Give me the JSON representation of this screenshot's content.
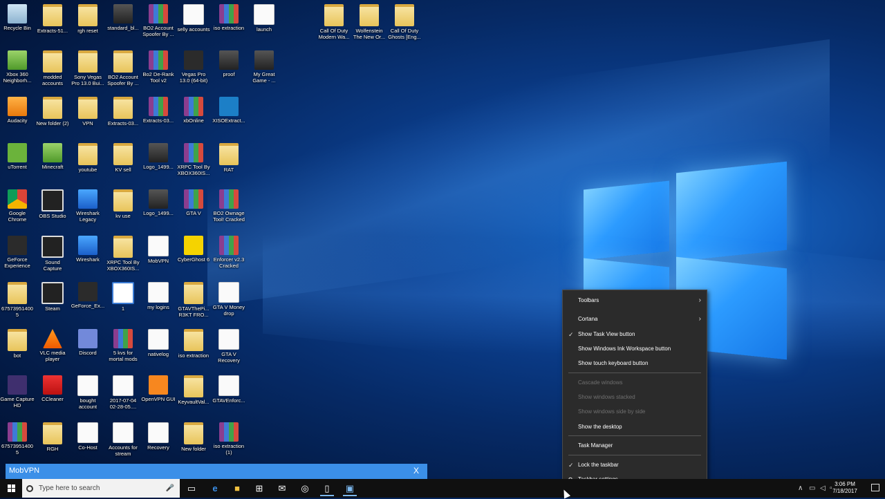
{
  "desktop": {
    "icons": [
      {
        "label": "Recycle Bin",
        "glyph": "recycle-bin-icon"
      },
      {
        "label": "Extracts-51...",
        "glyph": "folder-icon"
      },
      {
        "label": "rgh reset",
        "glyph": "folder-icon"
      },
      {
        "label": "standard_bl...",
        "glyph": "image-file-icon"
      },
      {
        "label": "BO2 Account Spoofer By ...",
        "glyph": "winrar-archive-icon"
      },
      {
        "label": "selly accounts",
        "glyph": "text-document-icon"
      },
      {
        "label": "iso extraction",
        "glyph": "winrar-archive-icon"
      },
      {
        "label": "launch",
        "glyph": "settings-file-icon"
      },
      {
        "label": "Call Of Duty Modern Wa...",
        "glyph": "folder-icon"
      },
      {
        "label": "Wolfenstein The New Or...",
        "glyph": "folder-icon"
      },
      {
        "label": "Call Of Duty Ghosts [Eng...",
        "glyph": "folder-icon"
      },
      {
        "label": "Xbox 360 Neighborh...",
        "glyph": "xbox-neighborhood-icon"
      },
      {
        "label": "modded accounts",
        "glyph": "folder-icon"
      },
      {
        "label": "Sony Vegas Pro 13.0 Bui...",
        "glyph": "folder-icon"
      },
      {
        "label": "BO2 Account Spoofer By ...",
        "glyph": "folder-icon"
      },
      {
        "label": "Bo2 De-Rank Tool v2",
        "glyph": "winrar-archive-icon"
      },
      {
        "label": "Vegas Pro 13.0 (64-bit)",
        "glyph": "vegas-pro-icon"
      },
      {
        "label": "proof",
        "glyph": "image-file-icon"
      },
      {
        "label": "My Great Game - ...",
        "glyph": "image-file-icon"
      },
      {
        "label": "Audacity",
        "glyph": "audacity-icon"
      },
      {
        "label": "New folder (2)",
        "glyph": "folder-icon"
      },
      {
        "label": "VPN",
        "glyph": "folder-icon"
      },
      {
        "label": "Extracts-03...",
        "glyph": "folder-icon"
      },
      {
        "label": "Extracts-03...",
        "glyph": "winrar-archive-icon"
      },
      {
        "label": "xbOnline",
        "glyph": "winrar-archive-icon"
      },
      {
        "label": "XISOExtract...",
        "glyph": "xiso-extract-icon"
      },
      {
        "label": "uTorrent",
        "glyph": "utorrent-icon"
      },
      {
        "label": "Minecraft",
        "glyph": "minecraft-icon"
      },
      {
        "label": "youtube",
        "glyph": "folder-icon"
      },
      {
        "label": "KV sell",
        "glyph": "folder-icon"
      },
      {
        "label": "Logo_1499...",
        "glyph": "image-file-icon"
      },
      {
        "label": "XRPC Tool By XBOX360IS...",
        "glyph": "winrar-archive-icon"
      },
      {
        "label": "RAT",
        "glyph": "folder-icon"
      },
      {
        "label": "Google Chrome",
        "glyph": "chrome-icon"
      },
      {
        "label": "OBS Studio",
        "glyph": "obs-studio-icon"
      },
      {
        "label": "Wireshark Legacy",
        "glyph": "wireshark-icon"
      },
      {
        "label": "kv use",
        "glyph": "folder-icon"
      },
      {
        "label": "Logo_1499...",
        "glyph": "image-file-icon"
      },
      {
        "label": "GTA V",
        "glyph": "winrar-archive-icon"
      },
      {
        "label": "BO2 Ownage Tool! Cracked",
        "glyph": "winrar-archive-icon"
      },
      {
        "label": "GeForce Experience",
        "glyph": "geforce-icon"
      },
      {
        "label": "Sound Capture",
        "glyph": "sound-capture-icon"
      },
      {
        "label": "Wireshark",
        "glyph": "wireshark-icon"
      },
      {
        "label": "XRPC Tool By XBOX360IS...",
        "glyph": "folder-icon"
      },
      {
        "label": "MobVPN",
        "glyph": "text-document-icon"
      },
      {
        "label": "CyberGhost 6",
        "glyph": "cyberghost-icon"
      },
      {
        "label": "Enforcer v2.3 Cracked",
        "glyph": "winrar-archive-icon"
      },
      {
        "label": "675739514005",
        "glyph": "folder-icon"
      },
      {
        "label": "Steam",
        "glyph": "steam-icon"
      },
      {
        "label": "GeForce_Ex...",
        "glyph": "geforce-icon"
      },
      {
        "label": "1",
        "glyph": "circle-app-icon"
      },
      {
        "label": "my logins",
        "glyph": "text-document-icon"
      },
      {
        "label": "GTAVThePi... R3KT FRO...",
        "glyph": "folder-icon"
      },
      {
        "label": "GTA V Money drop",
        "glyph": "text-document-icon"
      },
      {
        "label": "bot",
        "glyph": "folder-icon"
      },
      {
        "label": "VLC media player",
        "glyph": "vlc-icon"
      },
      {
        "label": "Discord",
        "glyph": "discord-icon"
      },
      {
        "label": "5 kvs for mortal mods",
        "glyph": "winrar-archive-icon"
      },
      {
        "label": "nativelog",
        "glyph": "text-document-icon"
      },
      {
        "label": "iso extraction",
        "glyph": "folder-icon"
      },
      {
        "label": "GTA V Recovery",
        "glyph": "text-document-icon"
      },
      {
        "label": "Game Capture HD",
        "glyph": "game-capture-icon"
      },
      {
        "label": "CCleaner",
        "glyph": "ccleaner-icon"
      },
      {
        "label": "bought account",
        "glyph": "text-document-icon"
      },
      {
        "label": "2017-07-04 02-28-05....",
        "glyph": "text-document-icon"
      },
      {
        "label": "OpenVPN GUI",
        "glyph": "openvpn-icon"
      },
      {
        "label": "KeyvaultVal...",
        "glyph": "folder-icon"
      },
      {
        "label": "GTAVEnforc...",
        "glyph": "text-document-icon"
      },
      {
        "label": "675739514005",
        "glyph": "winrar-archive-icon"
      },
      {
        "label": "RGH",
        "glyph": "folder-icon"
      },
      {
        "label": "Co-Host",
        "glyph": "text-document-icon"
      },
      {
        "label": "Accounts for stream",
        "glyph": "text-document-icon"
      },
      {
        "label": "Recovery",
        "glyph": "text-document-icon"
      },
      {
        "label": "New folder",
        "glyph": "folder-icon"
      },
      {
        "label": "iso extraction (1)",
        "glyph": "winrar-archive-icon"
      }
    ]
  },
  "mobvpn": {
    "title": "MobVPN",
    "close": "X"
  },
  "context_menu": {
    "items": [
      {
        "label": "Toolbars",
        "submenu": true,
        "enabled": true
      },
      {
        "label": "Cortana",
        "submenu": true,
        "enabled": true
      },
      {
        "label": "Show Task View button",
        "checked": true,
        "enabled": true
      },
      {
        "label": "Show Windows Ink Workspace button",
        "enabled": true
      },
      {
        "label": "Show touch keyboard button",
        "enabled": true
      },
      {
        "label": "Cascade windows",
        "enabled": false
      },
      {
        "label": "Show windows stacked",
        "enabled": false
      },
      {
        "label": "Show windows side by side",
        "enabled": false
      },
      {
        "label": "Show the desktop",
        "enabled": true
      },
      {
        "label": "Task Manager",
        "enabled": true
      },
      {
        "label": "Lock the taskbar",
        "checked": true,
        "enabled": true
      },
      {
        "label": "Taskbar settings",
        "icon": "gear-icon",
        "enabled": true
      }
    ],
    "chevron": "›",
    "checkmark": "✓",
    "gear": "⚙"
  },
  "taskbar": {
    "search_placeholder": "Type here to search",
    "apps": [
      "task-view-icon",
      "edge-icon",
      "file-explorer-icon",
      "store-icon",
      "mail-icon",
      "chrome-like-icon",
      "notepad-icon",
      "mobvpn-icon"
    ],
    "tray": {
      "chevron": "∧",
      "time": "3:06 PM",
      "date": "7/18/2017"
    }
  },
  "colors": {
    "accent": "#3b8fe8",
    "menu_bg": "#2b2b2b",
    "taskbar_bg": "#101010"
  }
}
